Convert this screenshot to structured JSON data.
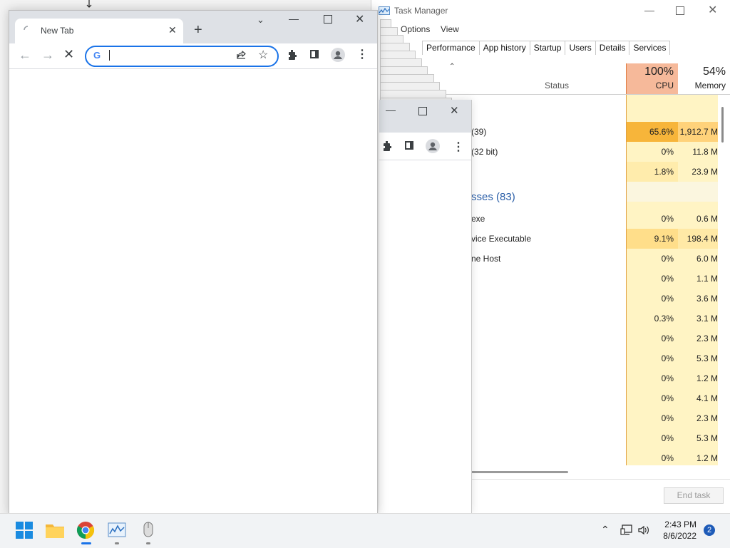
{
  "chrome": {
    "tab_title": "New Tab",
    "omnibox_value": ""
  },
  "chrome_bg": {},
  "task_manager": {
    "title": "Task Manager",
    "menu": [
      "Options",
      "View"
    ],
    "tabs": [
      "Performance",
      "App history",
      "Startup",
      "Users",
      "Details",
      "Services"
    ],
    "columns": {
      "status": "Status",
      "cpu_pct": "100%",
      "cpu_label": "CPU",
      "mem_pct": "54%",
      "mem_label": "Memory"
    },
    "apps_rows": [
      {
        "name": "(39)",
        "cpu": "65.6%",
        "mem": "1,912.7 M"
      },
      {
        "name": "(32 bit)",
        "cpu": "0%",
        "mem": "11.8 M"
      },
      {
        "name": "",
        "cpu": "1.8%",
        "mem": "23.9 M"
      }
    ],
    "group_title": "sses (83)",
    "bg_rows": [
      {
        "name": "exe",
        "cpu": "0%",
        "mem": "0.6 M"
      },
      {
        "name": "vice Executable",
        "cpu": "9.1%",
        "mem": "198.4 M"
      },
      {
        "name": "ne Host",
        "cpu": "0%",
        "mem": "6.0 M"
      },
      {
        "name": "",
        "cpu": "0%",
        "mem": "1.1 M"
      },
      {
        "name": "",
        "cpu": "0%",
        "mem": "3.6 M"
      },
      {
        "name": "",
        "cpu": "0.3%",
        "mem": "3.1 M"
      },
      {
        "name": "",
        "cpu": "0%",
        "mem": "2.3 M"
      },
      {
        "name": "",
        "cpu": "0%",
        "mem": "5.3 M"
      },
      {
        "name": "",
        "cpu": "0%",
        "mem": "1.2 M"
      },
      {
        "name": "",
        "cpu": "0%",
        "mem": "4.1 M"
      },
      {
        "name": "",
        "cpu": "0%",
        "mem": "2.3 M"
      },
      {
        "name": "",
        "cpu": "0%",
        "mem": "5.3 M"
      },
      {
        "name": "",
        "cpu": "0%",
        "mem": "1.2 M"
      }
    ],
    "end_task_label": "End task",
    "colors": {
      "cpu_header": "#f6b99a",
      "cpu_high": "#f7b53a",
      "cpu_mid": "#ffde8a",
      "cell": "#fff4c4"
    }
  },
  "taskbar": {
    "items": [
      "start-icon",
      "file-explorer-icon",
      "chrome-icon",
      "task-manager-icon",
      "mouse-icon"
    ],
    "time": "2:43 PM",
    "date": "8/6/2022",
    "notification_count": "2"
  }
}
